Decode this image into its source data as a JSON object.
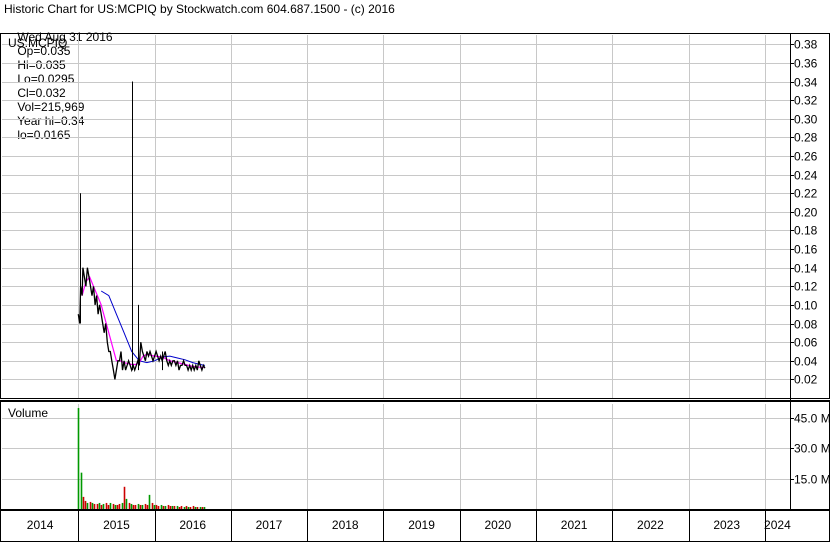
{
  "header": {
    "title": "Historic Chart for US:MCPIQ by Stockwatch.com 604.687.1500 - (c) 2016",
    "date": "Wed Aug 31 2016",
    "open": "Op=0.035",
    "high": "Hi=0.035",
    "low": "Lo=0.0295",
    "close": "Cl=0.032",
    "volume": "Vol=215,969",
    "year_high": "Year hi=0.34",
    "year_low": "lo=0.0165"
  },
  "colors": {
    "price": "#000000",
    "ma_short": "#ff00ff",
    "ma_long": "#0000cc",
    "volume_up": "#009900",
    "volume_down": "#cc0000",
    "grid": "#c8c8c8",
    "frame": "#000000"
  },
  "chart_data": [
    {
      "type": "line",
      "symbol_label": "US:MCPIQ",
      "x_unit": "year",
      "xlim": [
        2014.0,
        2024.33
      ],
      "ylim": [
        0.0,
        0.39
      ],
      "y_ticks": [
        "0.02",
        "0.04",
        "0.06",
        "0.08",
        "0.10",
        "0.12",
        "0.14",
        "0.16",
        "0.18",
        "0.20",
        "0.22",
        "0.24",
        "0.26",
        "0.28",
        "0.30",
        "0.32",
        "0.34",
        "0.36",
        "0.38"
      ],
      "grid": true,
      "series": [
        {
          "role": "price",
          "x": [
            2015.0,
            2015.02,
            2015.03,
            2015.05,
            2015.06,
            2015.08,
            2015.1,
            2015.12,
            2015.14,
            2015.16,
            2015.18,
            2015.2,
            2015.22,
            2015.24,
            2015.26,
            2015.28,
            2015.3,
            2015.32,
            2015.34,
            2015.36,
            2015.38,
            2015.4,
            2015.42,
            2015.44,
            2015.46,
            2015.48,
            2015.5,
            2015.52,
            2015.54,
            2015.56,
            2015.58,
            2015.6,
            2015.62,
            2015.64,
            2015.66,
            2015.68,
            2015.7,
            2015.72,
            2015.74,
            2015.76,
            2015.78,
            2015.8,
            2015.82,
            2015.84,
            2015.86,
            2015.88,
            2015.9,
            2015.92,
            2015.94,
            2015.96,
            2015.98,
            2016.0,
            2016.02,
            2016.04,
            2016.06,
            2016.08,
            2016.1,
            2016.12,
            2016.14,
            2016.16,
            2016.18,
            2016.2,
            2016.22,
            2016.24,
            2016.26,
            2016.28,
            2016.3,
            2016.32,
            2016.34,
            2016.36,
            2016.38,
            2016.4,
            2016.42,
            2016.44,
            2016.46,
            2016.48,
            2016.5,
            2016.52,
            2016.54,
            2016.56,
            2016.58,
            2016.6,
            2016.62,
            2016.64,
            2016.66
          ],
          "values": [
            0.09,
            0.08,
            0.12,
            0.11,
            0.14,
            0.13,
            0.12,
            0.14,
            0.13,
            0.12,
            0.11,
            0.12,
            0.1,
            0.11,
            0.09,
            0.1,
            0.09,
            0.08,
            0.07,
            0.08,
            0.06,
            0.05,
            0.05,
            0.04,
            0.03,
            0.02,
            0.03,
            0.04,
            0.04,
            0.05,
            0.03,
            0.04,
            0.03,
            0.035,
            0.04,
            0.035,
            0.03,
            0.035,
            0.03,
            0.035,
            0.04,
            0.035,
            0.06,
            0.05,
            0.045,
            0.04,
            0.05,
            0.045,
            0.05,
            0.045,
            0.04,
            0.045,
            0.05,
            0.045,
            0.04,
            0.045,
            0.04,
            0.045,
            0.05,
            0.04,
            0.035,
            0.04,
            0.035,
            0.04,
            0.04,
            0.035,
            0.04,
            0.03,
            0.035,
            0.035,
            0.04,
            0.035,
            0.035,
            0.03,
            0.035,
            0.03,
            0.035,
            0.03,
            0.035,
            0.03,
            0.04,
            0.035,
            0.03,
            0.035,
            0.032
          ]
        },
        {
          "role": "moving_average_short",
          "x": [
            2015.05,
            2015.1,
            2015.15,
            2015.2,
            2015.25,
            2015.3,
            2015.35,
            2015.4,
            2015.45,
            2015.5,
            2015.55,
            2015.6,
            2015.65,
            2015.7,
            2015.75,
            2015.8,
            2015.85,
            2015.9,
            2015.95,
            2016.0,
            2016.1,
            2016.2,
            2016.3,
            2016.4,
            2016.5,
            2016.6,
            2016.66
          ],
          "values": [
            0.11,
            0.125,
            0.13,
            0.12,
            0.11,
            0.1,
            0.085,
            0.07,
            0.055,
            0.04,
            0.04,
            0.038,
            0.037,
            0.036,
            0.036,
            0.038,
            0.045,
            0.047,
            0.046,
            0.045,
            0.044,
            0.04,
            0.038,
            0.036,
            0.034,
            0.033,
            0.033
          ]
        },
        {
          "role": "moving_average_long",
          "x": [
            2015.3,
            2015.4,
            2015.5,
            2015.6,
            2015.7,
            2015.8,
            2015.9,
            2016.0,
            2016.1,
            2016.2,
            2016.3,
            2016.4,
            2016.5,
            2016.6,
            2016.66
          ],
          "values": [
            0.115,
            0.11,
            0.09,
            0.07,
            0.05,
            0.04,
            0.038,
            0.04,
            0.044,
            0.045,
            0.043,
            0.041,
            0.038,
            0.036,
            0.035
          ]
        }
      ],
      "spikes": [
        {
          "x": 2015.02,
          "low": 0.08,
          "high": 0.22
        },
        {
          "x": 2015.7,
          "low": 0.03,
          "high": 0.34
        },
        {
          "x": 2015.78,
          "low": 0.03,
          "high": 0.1
        },
        {
          "x": 2016.1,
          "low": 0.03,
          "high": 0.05
        }
      ]
    },
    {
      "type": "bar",
      "title": "Volume",
      "unit": "M",
      "ylim": [
        0.0,
        52.0
      ],
      "y_ticks": [
        "15.0 M",
        "30.0 M",
        "45.0 M"
      ],
      "x": [
        2015.0,
        2015.03,
        2015.06,
        2015.09,
        2015.12,
        2015.15,
        2015.18,
        2015.21,
        2015.24,
        2015.27,
        2015.3,
        2015.33,
        2015.36,
        2015.39,
        2015.42,
        2015.45,
        2015.48,
        2015.51,
        2015.54,
        2015.57,
        2015.6,
        2015.63,
        2015.66,
        2015.69,
        2015.72,
        2015.75,
        2015.78,
        2015.81,
        2015.84,
        2015.87,
        2015.9,
        2015.93,
        2015.96,
        2015.99,
        2016.02,
        2016.05,
        2016.08,
        2016.11,
        2016.14,
        2016.17,
        2016.2,
        2016.23,
        2016.26,
        2016.29,
        2016.32,
        2016.35,
        2016.38,
        2016.41,
        2016.44,
        2016.47,
        2016.5,
        2016.53,
        2016.56,
        2016.59,
        2016.62,
        2016.65
      ],
      "values": [
        50.0,
        18.0,
        6.0,
        4.0,
        3.0,
        3.5,
        3.0,
        2.5,
        2.5,
        3.0,
        2.0,
        2.5,
        3.0,
        2.0,
        3.0,
        2.5,
        2.0,
        2.0,
        2.5,
        3.0,
        11.0,
        5.0,
        3.0,
        2.5,
        2.0,
        2.0,
        2.5,
        2.0,
        2.0,
        2.5,
        2.0,
        7.0,
        3.0,
        2.0,
        2.0,
        1.5,
        2.0,
        1.5,
        1.5,
        2.0,
        1.5,
        1.5,
        1.5,
        1.5,
        1.0,
        1.5,
        1.0,
        1.5,
        1.0,
        1.0,
        1.5,
        1.0,
        1.0,
        1.0,
        1.0,
        1.0
      ],
      "up": [
        true,
        true,
        false,
        false,
        true,
        false,
        true,
        false,
        false,
        true,
        false,
        true,
        false,
        false,
        true,
        false,
        true,
        false,
        false,
        true,
        false,
        true,
        false,
        true,
        false,
        false,
        true,
        false,
        true,
        false,
        false,
        true,
        false,
        true,
        false,
        false,
        true,
        false,
        true,
        false,
        false,
        true,
        false,
        true,
        false,
        false,
        true,
        false,
        true,
        false,
        false,
        true,
        false,
        true,
        false,
        true
      ]
    }
  ],
  "x_axis": {
    "labels": [
      {
        "text": "2014",
        "x": 2014.0
      },
      {
        "text": "2015",
        "x": 2015.0
      },
      {
        "text": "2016",
        "x": 2016.0
      },
      {
        "text": "2017",
        "x": 2017.0
      },
      {
        "text": "2018",
        "x": 2018.0
      },
      {
        "text": "2019",
        "x": 2019.0
      },
      {
        "text": "2020",
        "x": 2020.0
      },
      {
        "text": "2021",
        "x": 2021.0
      },
      {
        "text": "2022",
        "x": 2022.0
      },
      {
        "text": "2023",
        "x": 2023.0
      },
      {
        "text": "2024",
        "x": 2024.0
      }
    ]
  }
}
